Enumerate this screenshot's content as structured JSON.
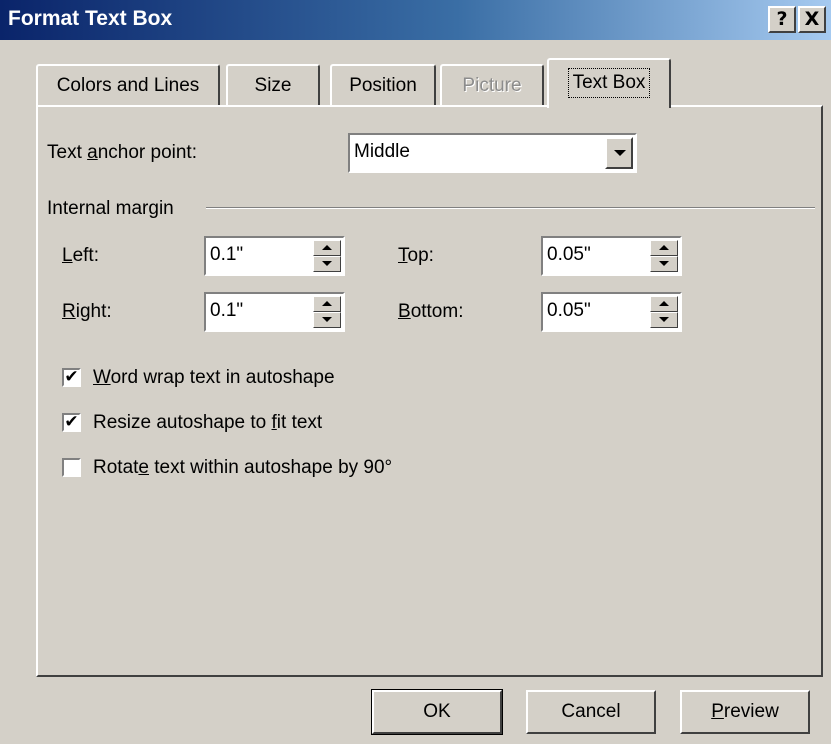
{
  "window": {
    "title": "Format Text Box",
    "help_label": "?",
    "close_label": "X"
  },
  "tabs": [
    {
      "label": "Colors and Lines"
    },
    {
      "label": "Size"
    },
    {
      "label": "Position"
    },
    {
      "label": "Picture",
      "disabled": true
    },
    {
      "label": "Text Box",
      "active": true
    }
  ],
  "text_box": {
    "anchor_label_pre": "Text ",
    "anchor_label_key": "a",
    "anchor_label_post": "nchor point:",
    "anchor_value": "Middle",
    "internal_margin_label": "Internal margin",
    "left_label_key": "L",
    "left_label_post": "eft:",
    "left_value": "0.1\"",
    "right_label_key": "R",
    "right_label_post": "ight:",
    "right_value": "0.1\"",
    "top_label_key": "T",
    "top_label_post": "op:",
    "top_value": "0.05\"",
    "bottom_label_key": "B",
    "bottom_label_post": "ottom:",
    "bottom_value": "0.05\"",
    "word_wrap_key": "W",
    "word_wrap_post": "ord wrap text in autoshape",
    "word_wrap_checked": true,
    "resize_pre": "Resize autoshape to ",
    "resize_key": "f",
    "resize_post": "it text",
    "resize_checked": true,
    "rotate_pre": "Rotat",
    "rotate_key": "e",
    "rotate_post": " text within autoshape by 90°",
    "rotate_checked": false
  },
  "buttons": {
    "ok": "OK",
    "cancel": "Cancel",
    "preview_key": "P",
    "preview_post": "review"
  },
  "icons": {
    "check": "✔"
  },
  "colors": {
    "title_start": "#0a246a",
    "title_end": "#a6caf0",
    "face": "#d4d0c8"
  }
}
